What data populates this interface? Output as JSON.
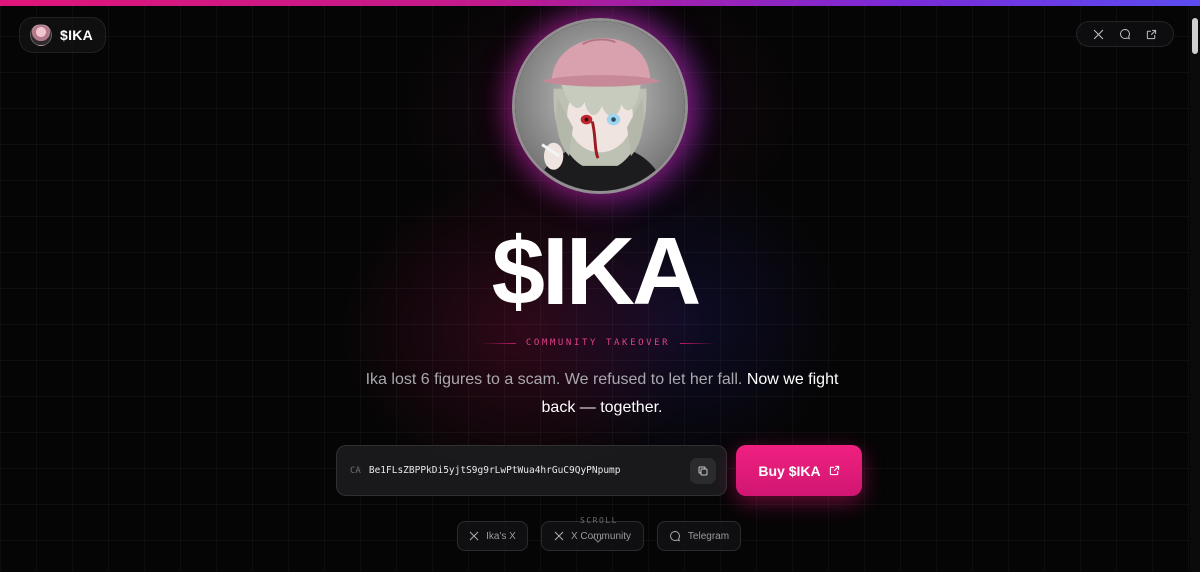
{
  "brand": {
    "name": "$IKA",
    "avatar_icon": "ika-avatar-icon"
  },
  "header": {
    "social_icons": [
      "x-icon",
      "chat-bubble-icon",
      "external-link-icon"
    ]
  },
  "hero": {
    "title": "$IKA",
    "subtitle": "COMMUNITY TAKEOVER",
    "tagline_muted": "Ika lost 6 figures to a scam. We refused to let her fall. ",
    "tagline_strong": "Now we fight back — together."
  },
  "contract": {
    "label": "CA",
    "address": "Be1FLsZBPPkDi5yjtS9g9rLwPtWua4hrGuC9QyPNpump",
    "copy_icon": "copy-icon"
  },
  "buy_button": {
    "label": "Buy $IKA",
    "icon": "external-link-icon"
  },
  "links": [
    {
      "label": "Ika's X",
      "icon": "x-icon"
    },
    {
      "label": "X Community",
      "icon": "x-icon"
    },
    {
      "label": "Telegram",
      "icon": "chat-bubble-icon"
    }
  ],
  "scroll_hint": "SCROLL",
  "colors": {
    "accent_pink": "#e0157a",
    "accent_purple": "#5b4cf0",
    "background": "#050505"
  }
}
